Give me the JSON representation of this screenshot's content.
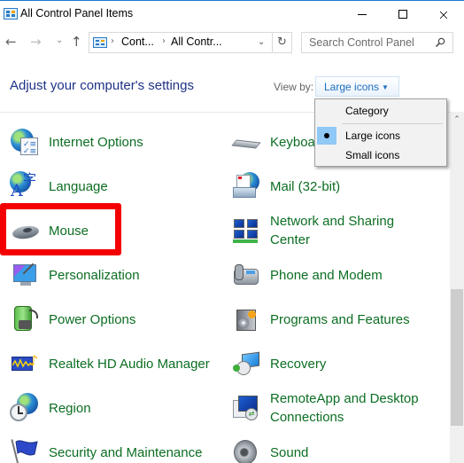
{
  "window": {
    "title": "All Control Panel Items",
    "controls": {
      "minimize": "minimize",
      "maximize": "maximize",
      "close": "×"
    }
  },
  "nav": {
    "back": "←",
    "forward": "→",
    "recent": "⌄",
    "up": "↑",
    "breadcrumb": [
      "Cont...",
      "All Contr..."
    ],
    "breadcrumb_separator": "›",
    "address_dropdown": "⌄",
    "refresh": "↻",
    "search_placeholder": "Search Control Panel",
    "search_value": ""
  },
  "header": {
    "title": "Adjust your computer's settings",
    "view_by_label": "View by:",
    "view_by_value": "Large icons",
    "view_by_caret": "▼"
  },
  "view_menu": {
    "items": [
      {
        "label": "Category",
        "selected": false
      },
      {
        "label": "Large icons",
        "selected": true
      },
      {
        "label": "Small icons",
        "selected": false
      }
    ]
  },
  "items_left": [
    {
      "label": "Internet Options",
      "icon": "internet-options-icon"
    },
    {
      "label": "Language",
      "icon": "language-icon"
    },
    {
      "label": "Mouse",
      "icon": "mouse-icon",
      "highlighted": true
    },
    {
      "label": "Personalization",
      "icon": "personalization-icon"
    },
    {
      "label": "Power Options",
      "icon": "power-options-icon"
    },
    {
      "label": "Realtek HD Audio Manager",
      "icon": "realtek-audio-icon"
    },
    {
      "label": "Region",
      "icon": "region-icon"
    },
    {
      "label": "Security and Maintenance",
      "icon": "security-flag-icon"
    }
  ],
  "items_right": [
    {
      "label": "Keyboard",
      "visible_label": "Keyboa",
      "icon": "keyboard-icon"
    },
    {
      "label": "Mail (32-bit)",
      "icon": "mail-icon"
    },
    {
      "label": "Network and Sharing Center",
      "line1": "Network and Sharing",
      "line2": "Center",
      "icon": "network-icon"
    },
    {
      "label": "Phone and Modem",
      "icon": "phone-modem-icon"
    },
    {
      "label": "Programs and Features",
      "icon": "programs-features-icon"
    },
    {
      "label": "Recovery",
      "icon": "recovery-icon"
    },
    {
      "label": "RemoteApp and Desktop Connections",
      "line1": "RemoteApp and Desktop",
      "line2": "Connections",
      "icon": "remoteapp-icon"
    },
    {
      "label": "Sound",
      "icon": "sound-icon"
    }
  ],
  "scrollbar": {
    "up_arrow": "⌃",
    "position_fraction": 0.5
  },
  "colors": {
    "item_link": "#0c6e23",
    "heading": "#1e3287",
    "highlight": "#f40000",
    "accent": "#1979ca"
  }
}
